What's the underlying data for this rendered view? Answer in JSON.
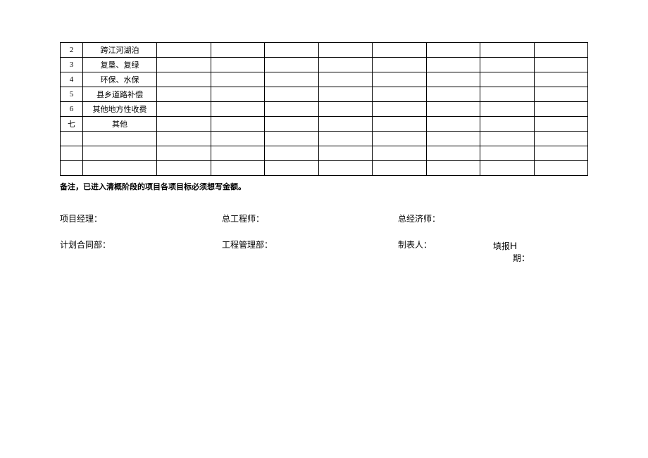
{
  "table": {
    "rows": [
      {
        "idx": "2",
        "item": "跨江河湖泊",
        "cols": [
          "",
          "",
          "",
          "",
          "",
          "",
          "",
          ""
        ]
      },
      {
        "idx": "3",
        "item": "复垦、复绿",
        "cols": [
          "",
          "",
          "",
          "",
          "",
          "",
          "",
          ""
        ]
      },
      {
        "idx": "4",
        "item": "环保、水保",
        "cols": [
          "",
          "",
          "",
          "",
          "",
          "",
          "",
          ""
        ]
      },
      {
        "idx": "5",
        "item": "县乡道路补偿",
        "cols": [
          "",
          "",
          "",
          "",
          "",
          "",
          "",
          ""
        ]
      },
      {
        "idx": "6",
        "item": "其他地方性收费",
        "cols": [
          "",
          "",
          "",
          "",
          "",
          "",
          "",
          ""
        ]
      },
      {
        "idx": "七",
        "item": "其他",
        "cols": [
          "",
          "",
          "",
          "",
          "",
          "",
          "",
          ""
        ]
      },
      {
        "idx": "",
        "item": "",
        "cols": [
          "",
          "",
          "",
          "",
          "",
          "",
          "",
          ""
        ]
      },
      {
        "idx": "",
        "item": "",
        "cols": [
          "",
          "",
          "",
          "",
          "",
          "",
          "",
          ""
        ]
      },
      {
        "idx": "",
        "item": "",
        "cols": [
          "",
          "",
          "",
          "",
          "",
          "",
          "",
          ""
        ]
      }
    ]
  },
  "note": "备注，已进入清概阶段的项目各项目标必须想写金额。",
  "signatures": {
    "row1": {
      "pm": "项目经理：",
      "chief_eng": "总工程师：",
      "chief_econ": "总经济师："
    },
    "row2": {
      "plan_contract": "计划合同部：",
      "proj_mgmt": "工程管理部：",
      "preparer": "制表人：",
      "fill_label_prefix": "填报",
      "fill_label_big": "H",
      "fill_label_suffix": "期："
    }
  }
}
